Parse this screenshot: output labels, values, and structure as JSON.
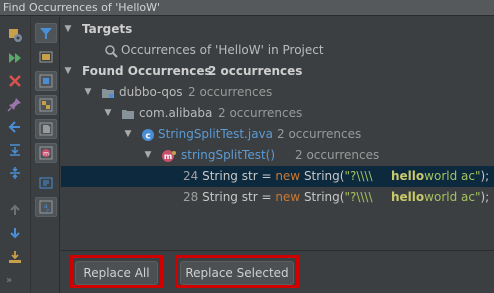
{
  "window": {
    "title": "Find Occurrences of 'HelloW'"
  },
  "tree": {
    "targets": {
      "label": "Targets",
      "child": "Occurrences of 'HelloW' in Project"
    },
    "found": {
      "label": "Found Occurrences",
      "count": "2 occurrences",
      "module": {
        "label": "dubbo-qos",
        "count": "2 occurrences"
      },
      "package": {
        "label": "com.alibaba",
        "count": "2 occurrences"
      },
      "file": {
        "label": "StringSplitTest.java",
        "count": "2 occurrences"
      },
      "method": {
        "label": "stringSplitTest()",
        "count": "2 occurrences"
      },
      "results": [
        {
          "line": "24",
          "code_prefix": "String str = ",
          "keyword": "new",
          "code_mid": " String(",
          "string_start": "\"?\\\\\\\\",
          "match": "hello",
          "string_end": "world ac\"",
          "code_suffix": ");"
        },
        {
          "line": "28",
          "code_prefix": "String str = ",
          "keyword": "new",
          "code_mid": " String(",
          "string_start": "\"?\\\\\\\\",
          "match": "hello",
          "string_end": "world ac\"",
          "code_suffix": ");"
        }
      ]
    }
  },
  "buttons": {
    "replace_all": "Replace All",
    "replace_selected": "Replace Selected"
  },
  "icons": {
    "toolbar_left": [
      "settings-icon",
      "rerun-icon",
      "close-icon",
      "pin-icon",
      "previous-occurrence-icon",
      "expand-all-icon",
      "collapse-all-icon",
      "up-arrow-icon",
      "down-arrow-icon",
      "export-icon"
    ],
    "toolbar_right": [
      "filter-icon",
      "preview-icon",
      "group-by-module-icon",
      "group-by-package-icon",
      "group-by-file-icon",
      "group-by-method-icon",
      "autoscroll-icon",
      "sort-icon"
    ]
  },
  "colors": {
    "selection": "#0d293e",
    "highlight_box": "#d00000",
    "link": "#5b9bd5",
    "keyword": "#cc7832",
    "string": "#a5c261",
    "match": "#c9c96b"
  }
}
